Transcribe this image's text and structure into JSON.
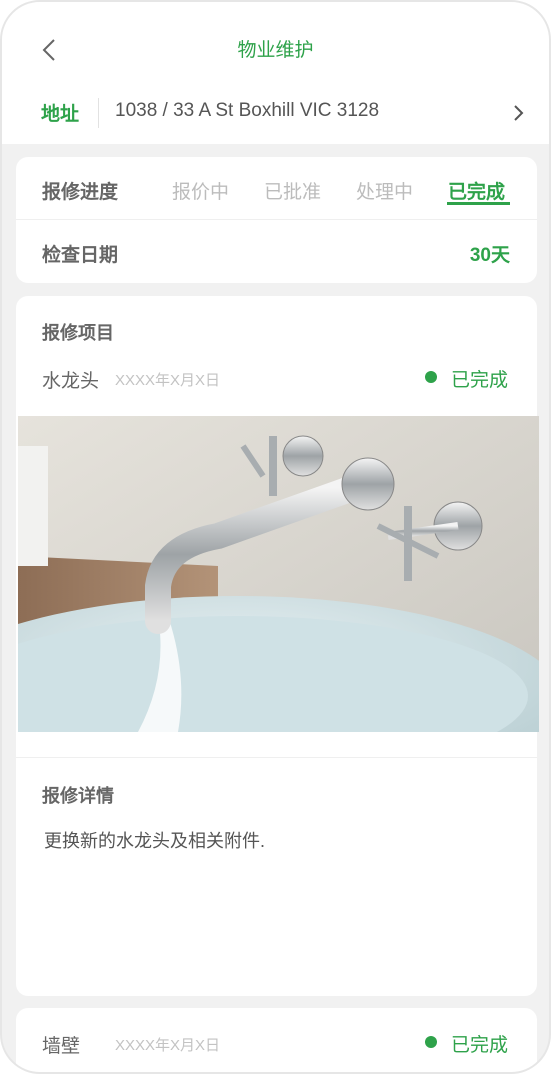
{
  "header": {
    "title": "物业维护",
    "back_icon": "chevron-left-icon"
  },
  "address": {
    "label": "地址",
    "value": "1038 / 33 A St Boxhill VIC 3128",
    "arrow_icon": "chevron-right-icon"
  },
  "progress": {
    "label": "报修进度",
    "steps": [
      "报价中",
      "已批准",
      "处理中",
      "已完成"
    ],
    "active_step": "已完成"
  },
  "inspection": {
    "label": "检查日期",
    "value": "30天"
  },
  "repair_items": {
    "title": "报修项目",
    "items": [
      {
        "name": "水龙头",
        "date": "XXXX年X月X日",
        "status": "已完成"
      }
    ],
    "photo_icon": "faucet-photo"
  },
  "details": {
    "title": "报修详情",
    "text": "更换新的水龙头及相关附件."
  },
  "next_item": {
    "name": "墙壁",
    "date": "XXXX年X月X日",
    "status": "已完成"
  },
  "colors": {
    "accent": "#2ea24a",
    "background": "#f1f1f1",
    "muted": "#bcbcbc"
  }
}
